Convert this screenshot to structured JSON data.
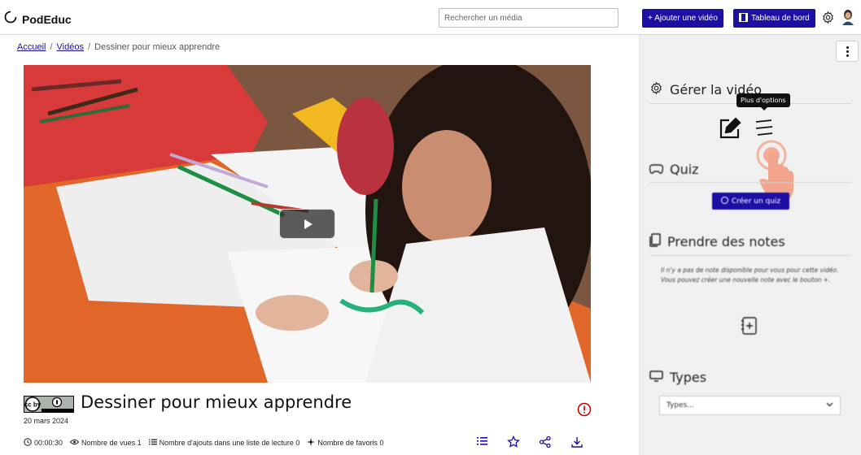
{
  "navbar": {
    "brand": "PodEduc",
    "search_placeholder": "Rechercher un média",
    "add_video_label": "+ Ajouter une vidéo",
    "dashboard_label": "Tableau de bord"
  },
  "breadcrumb": {
    "home": "Accueil",
    "videos": "Vidéos",
    "current": "Dessiner pour mieux apprendre"
  },
  "video": {
    "title": "Dessiner pour mieux apprendre",
    "date": "20 mars 2024",
    "license_badge": "cc by",
    "duration": "00:00:30",
    "views": "Nombre de vues 1",
    "playlist_adds": "Nombre d'ajouts dans une liste de lecture 0",
    "favorites": "Nombre de favoris 0"
  },
  "sidebar": {
    "manage_heading": "Gérer la vidéo",
    "tooltip": "Plus d'options",
    "quiz_heading": "Quiz",
    "quiz_button": "Créer un quiz",
    "notes_heading": "Prendre des notes",
    "notes_empty": "Il n'y a pas de note disponible pour vous pour cette vidéo.",
    "notes_hint": "Vous pouvez créer une nouvelle note avec le bouton +.",
    "types_heading": "Types",
    "types_placeholder": "Types..."
  },
  "colors": {
    "primary": "#1d0fa4",
    "sidebar_bg": "#f0f0f0",
    "report_red": "#c00000",
    "hand_pink": "#f1a58c"
  }
}
